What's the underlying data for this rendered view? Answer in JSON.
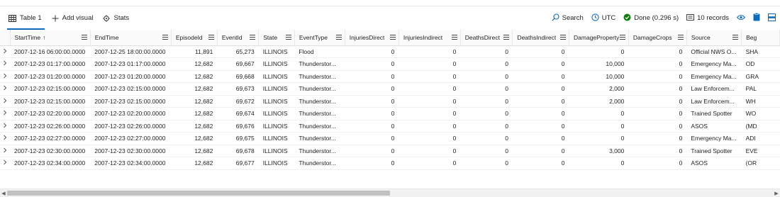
{
  "toolbar": {
    "tabs": [
      {
        "label": "Table 1",
        "icon": "table-icon",
        "active": true
      },
      {
        "label": "Add visual",
        "icon": "plus-icon",
        "active": false
      },
      {
        "label": "Stats",
        "icon": "stats-icon",
        "active": false
      }
    ],
    "search_label": "Search",
    "timezone_label": "UTC",
    "status_label": "Done (0.296 s)",
    "records_label": "10 records",
    "accent_color": "#0f6cbd",
    "success_color": "#107c10"
  },
  "grid": {
    "sorted_column": "StartTime",
    "sort_direction": "ascending",
    "columns": [
      "StartTime",
      "EndTime",
      "EpisodeId",
      "EventId",
      "State",
      "EventType",
      "InjuriesDirect",
      "InjuriesIndirect",
      "DeathsDirect",
      "DeathsIndirect",
      "DamageProperty",
      "DamageCrops",
      "Source",
      "Beg"
    ],
    "rows": [
      [
        "2007-12-16 06:00:00.0000",
        "2007-12-25 18:00:00.0000",
        "11,891",
        "65,273",
        "ILLINOIS",
        "Flood",
        "0",
        "0",
        "0",
        "0",
        "0",
        "0",
        "Official NWS O...",
        "SHA"
      ],
      [
        "2007-12-23 01:17:00.0000",
        "2007-12-23 01:17:00.0000",
        "12,682",
        "69,667",
        "ILLINOIS",
        "Thunderstor...",
        "0",
        "0",
        "0",
        "0",
        "10,000",
        "0",
        "Emergency Ma...",
        "OD"
      ],
      [
        "2007-12-23 01:20:00.0000",
        "2007-12-23 01:20:00.0000",
        "12,682",
        "69,668",
        "ILLINOIS",
        "Thunderstor...",
        "0",
        "0",
        "0",
        "0",
        "10,000",
        "0",
        "Emergency Ma...",
        "GRA"
      ],
      [
        "2007-12-23 02:15:00.0000",
        "2007-12-23 02:15:00.0000",
        "12,682",
        "69,673",
        "ILLINOIS",
        "Thunderstor...",
        "0",
        "0",
        "0",
        "0",
        "2,000",
        "0",
        "Law Enforcem...",
        "PAL"
      ],
      [
        "2007-12-23 02:15:00.0000",
        "2007-12-23 02:15:00.0000",
        "12,682",
        "69,672",
        "ILLINOIS",
        "Thunderstor...",
        "0",
        "0",
        "0",
        "0",
        "2,000",
        "0",
        "Law Enforcem...",
        "WH"
      ],
      [
        "2007-12-23 02:20:00.0000",
        "2007-12-23 02:20:00.0000",
        "12,682",
        "69,674",
        "ILLINOIS",
        "Thunderstor...",
        "0",
        "0",
        "0",
        "0",
        "0",
        "0",
        "Trained Spotter",
        "WO"
      ],
      [
        "2007-12-23 02:26:00.0000",
        "2007-12-23 02:26:00.0000",
        "12,682",
        "69,676",
        "ILLINOIS",
        "Thunderstor...",
        "0",
        "0",
        "0",
        "0",
        "0",
        "0",
        "ASOS",
        "(MD"
      ],
      [
        "2007-12-23 02:27:00.0000",
        "2007-12-23 02:27:00.0000",
        "12,682",
        "69,675",
        "ILLINOIS",
        "Thunderstor...",
        "0",
        "0",
        "0",
        "0",
        "0",
        "0",
        "Emergency Ma...",
        "ADI"
      ],
      [
        "2007-12-23 02:30:00.0000",
        "2007-12-23 02:30:00.0000",
        "12,682",
        "69,678",
        "ILLINOIS",
        "Thunderstor...",
        "0",
        "0",
        "0",
        "0",
        "3,000",
        "0",
        "Trained Spotter",
        "EVE"
      ],
      [
        "2007-12-23 02:34:00.0000",
        "2007-12-23 02:34:00.0000",
        "12,682",
        "69,677",
        "ILLINOIS",
        "Thunderstor...",
        "0",
        "0",
        "0",
        "0",
        "0",
        "0",
        "ASOS",
        "(OR"
      ]
    ]
  }
}
